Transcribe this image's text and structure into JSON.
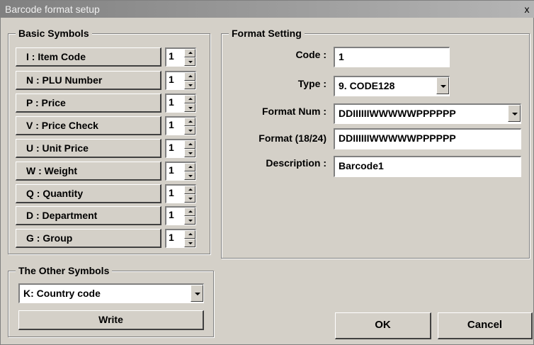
{
  "window": {
    "title": "Barcode format setup",
    "close_glyph": "x"
  },
  "basic_symbols": {
    "label": "Basic Symbols",
    "items": [
      {
        "label": "I : Item Code",
        "count": "1"
      },
      {
        "label": "N : PLU Number",
        "count": "1"
      },
      {
        "label": "P : Price",
        "count": "1"
      },
      {
        "label": "V : Price Check",
        "count": "1"
      },
      {
        "label": "U : Unit Price",
        "count": "1"
      },
      {
        "label": "W : Weight",
        "count": "1"
      },
      {
        "label": "Q : Quantity",
        "count": "1"
      },
      {
        "label": "D : Department",
        "count": "1"
      },
      {
        "label": "G : Group",
        "count": "1"
      }
    ]
  },
  "other_symbols": {
    "label": "The Other Symbols",
    "selected": "K: Country code",
    "write_label": "Write"
  },
  "format_setting": {
    "label": "Format Setting",
    "code_label": "Code :",
    "code_value": "1",
    "type_label": "Type :",
    "type_value": "9. CODE128",
    "format_num_label": "Format Num :",
    "format_num_value": "DDIIIIIIWWWWWPPPPPP",
    "format_label": "Format (18/24)",
    "format_value": "DDIIIIIIWWWWWPPPPPP",
    "description_label": "Description :",
    "description_value": "Barcode1"
  },
  "buttons": {
    "ok_label": "OK",
    "cancel_label": "Cancel"
  }
}
